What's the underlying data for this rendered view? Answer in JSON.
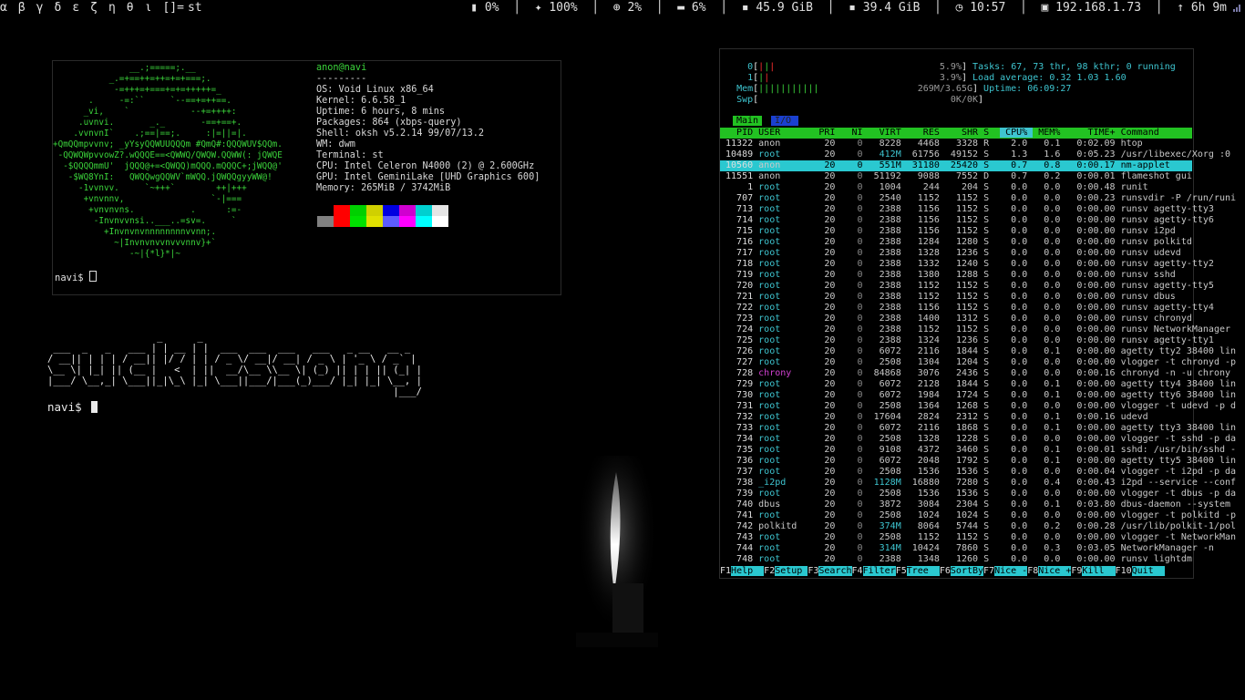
{
  "bar": {
    "tags": [
      "α",
      "β",
      "γ",
      "δ",
      "ε",
      "ζ",
      "η",
      "θ",
      "ι"
    ],
    "layout": "[]=",
    "window_title": "st",
    "battery": "0%",
    "brightness": "100%",
    "cpu": "2%",
    "memory": "6%",
    "disk1": "45.9 GiB",
    "disk2": "39.4 GiB",
    "clock": "10:57",
    "ip": "192.168.1.73",
    "uptime": "6h 9m"
  },
  "neofetch": {
    "userhost": "anon@navi",
    "separator": "---------",
    "lines": [
      "OS: Void Linux x86_64",
      "Kernel: 6.6.58_1",
      "Uptime: 6 hours, 8 mins",
      "Packages: 864 (xbps-query)",
      "Shell: oksh v5.2.14 99/07/13.2",
      "WM: dwm",
      "Terminal: st",
      "CPU: Intel Celeron N4000 (2) @ 2.600GHz",
      "GPU: Intel GeminiLake [UHD Graphics 600]",
      "Memory: 265MiB / 3742MiB"
    ],
    "logo": [
      "               __.;=====;.__",
      "           _.=+==++=++=+=+===;.",
      "            -=+++=+===+=+=+++++=_",
      "       .     -=:``     `--==+=++==.",
      "      _vi,    `            --+=++++:",
      "     .uvnvi.       _._       -==+==+.",
      "    .vvnvnI`    .;==|==;.     :|=||=|.",
      "+QmQQmpvvnv; _yYsyQQWUUQQQm #QmQ#:QQQWUV$QQm.",
      " -QQWQWpvvowZ?.wQQQE==<QWWQ/QWQW.QQWW(: jQWQE",
      "  -$QQQQmmU'  jQQQ@+=<QWQQ)mQQQ.mQQQC+;jWQQ@'",
      "   -$WQ8YnI:   QWQQwgQQWV`mWQQ.jQWQQgyyWW@!",
      "     -1vvnvv.     `~+++`        ++|+++",
      "      +vnvnnv,                 `-|===",
      "       +vnvnvns.           .      :=-",
      "        -Invnvvnsi..___..=sv=.     `",
      "          +Invnvnvnnnnnnnnvvnn;.",
      "            ~|Invnvnvvnvvvnnv}+`",
      "               -~|{*l}*|~"
    ],
    "prompt": "navi$ "
  },
  "figlet_lines": [
    "                   _      _",
    " ___  _   _   ___ | | __ | |  ___  ___  ___   ___   _ __   __ _",
    "/ __|| | | | / __|| |/ / | | / _ \\/ __|/ __| / _ \\ | '_ \\ / _` |",
    "\\__ \\| |_| || (__ |   <  | ||  __/\\__ \\\\__ \\| (_) || | | || (_| |",
    "|___/ \\__,_| \\___||_|\\_\\ |_| \\___||___/|___(_)___/ |_| |_| \\__, |",
    "                                                            |___/"
  ],
  "prompt2": "navi$ ",
  "htop": {
    "cpu0_label": "0",
    "cpu0_pct": "5.9%",
    "cpu1_label": "1",
    "cpu1_pct": "3.9%",
    "mem_label": "Mem",
    "mem_val": "269M/3.65G",
    "swp_label": "Swp",
    "swp_val": "0K/0K",
    "tasks": "Tasks: 67, 73 thr, 98 kthr; 0 running",
    "load": "Load average: 0.32 1.03 1.60",
    "uptime": "Uptime: 06:09:27",
    "tab_main": "Main",
    "tab_io": "I/O",
    "columns": [
      "PID",
      "USER",
      "PRI",
      "NI",
      "VIRT",
      "RES",
      "SHR",
      "S",
      "CPU%",
      "MEM%",
      "TIME+",
      "Command"
    ],
    "processes": [
      [
        "11322",
        "anon",
        "20",
        "0",
        "8228",
        "4468",
        "3328",
        "R",
        "2.0",
        "0.1",
        "0:02.09",
        "htop"
      ],
      [
        "10489",
        "root",
        "20",
        "0",
        "412M",
        "61756",
        "49152",
        "S",
        "1.3",
        "1.6",
        "0:05.23",
        "/usr/libexec/Xorg :0"
      ],
      [
        "10560",
        "anon",
        "20",
        "0",
        "551M",
        "31180",
        "25420",
        "S",
        "0.7",
        "0.8",
        "0:00.17",
        "nm-applet"
      ],
      [
        "11551",
        "anon",
        "20",
        "0",
        "51192",
        "9088",
        "7552",
        "D",
        "0.7",
        "0.2",
        "0:00.01",
        "flameshot gui"
      ],
      [
        "1",
        "root",
        "20",
        "0",
        "1004",
        "244",
        "204",
        "S",
        "0.0",
        "0.0",
        "0:00.48",
        "runit"
      ],
      [
        "707",
        "root",
        "20",
        "0",
        "2540",
        "1152",
        "1152",
        "S",
        "0.0",
        "0.0",
        "0:00.23",
        "runsvdir -P /run/runi"
      ],
      [
        "713",
        "root",
        "20",
        "0",
        "2388",
        "1156",
        "1152",
        "S",
        "0.0",
        "0.0",
        "0:00.00",
        "runsv agetty-tty3"
      ],
      [
        "714",
        "root",
        "20",
        "0",
        "2388",
        "1156",
        "1152",
        "S",
        "0.0",
        "0.0",
        "0:00.00",
        "runsv agetty-tty6"
      ],
      [
        "715",
        "root",
        "20",
        "0",
        "2388",
        "1156",
        "1152",
        "S",
        "0.0",
        "0.0",
        "0:00.00",
        "runsv i2pd"
      ],
      [
        "716",
        "root",
        "20",
        "0",
        "2388",
        "1284",
        "1280",
        "S",
        "0.0",
        "0.0",
        "0:00.00",
        "runsv polkitd"
      ],
      [
        "717",
        "root",
        "20",
        "0",
        "2388",
        "1328",
        "1236",
        "S",
        "0.0",
        "0.0",
        "0:00.00",
        "runsv udevd"
      ],
      [
        "718",
        "root",
        "20",
        "0",
        "2388",
        "1332",
        "1240",
        "S",
        "0.0",
        "0.0",
        "0:00.00",
        "runsv agetty-tty2"
      ],
      [
        "719",
        "root",
        "20",
        "0",
        "2388",
        "1380",
        "1288",
        "S",
        "0.0",
        "0.0",
        "0:00.00",
        "runsv sshd"
      ],
      [
        "720",
        "root",
        "20",
        "0",
        "2388",
        "1152",
        "1152",
        "S",
        "0.0",
        "0.0",
        "0:00.00",
        "runsv agetty-tty5"
      ],
      [
        "721",
        "root",
        "20",
        "0",
        "2388",
        "1152",
        "1152",
        "S",
        "0.0",
        "0.0",
        "0:00.00",
        "runsv dbus"
      ],
      [
        "722",
        "root",
        "20",
        "0",
        "2388",
        "1156",
        "1152",
        "S",
        "0.0",
        "0.0",
        "0:00.00",
        "runsv agetty-tty4"
      ],
      [
        "723",
        "root",
        "20",
        "0",
        "2388",
        "1400",
        "1312",
        "S",
        "0.0",
        "0.0",
        "0:00.00",
        "runsv chronyd"
      ],
      [
        "724",
        "root",
        "20",
        "0",
        "2388",
        "1152",
        "1152",
        "S",
        "0.0",
        "0.0",
        "0:00.00",
        "runsv NetworkManager"
      ],
      [
        "725",
        "root",
        "20",
        "0",
        "2388",
        "1324",
        "1236",
        "S",
        "0.0",
        "0.0",
        "0:00.00",
        "runsv agetty-tty1"
      ],
      [
        "726",
        "root",
        "20",
        "0",
        "6072",
        "2116",
        "1844",
        "S",
        "0.0",
        "0.1",
        "0:00.00",
        "agetty tty2 38400 lin"
      ],
      [
        "727",
        "root",
        "20",
        "0",
        "2508",
        "1304",
        "1204",
        "S",
        "0.0",
        "0.0",
        "0:00.00",
        "vlogger -t chronyd -p"
      ],
      [
        "728",
        "chrony",
        "20",
        "0",
        "84868",
        "3076",
        "2436",
        "S",
        "0.0",
        "0.0",
        "0:00.16",
        "chronyd -n -u chrony"
      ],
      [
        "729",
        "root",
        "20",
        "0",
        "6072",
        "2128",
        "1844",
        "S",
        "0.0",
        "0.1",
        "0:00.00",
        "agetty tty4 38400 lin"
      ],
      [
        "730",
        "root",
        "20",
        "0",
        "6072",
        "1984",
        "1724",
        "S",
        "0.0",
        "0.1",
        "0:00.00",
        "agetty tty6 38400 lin"
      ],
      [
        "731",
        "root",
        "20",
        "0",
        "2508",
        "1364",
        "1268",
        "S",
        "0.0",
        "0.0",
        "0:00.00",
        "vlogger -t udevd -p d"
      ],
      [
        "732",
        "root",
        "20",
        "0",
        "17604",
        "2824",
        "2312",
        "S",
        "0.0",
        "0.1",
        "0:00.16",
        "udevd"
      ],
      [
        "733",
        "root",
        "20",
        "0",
        "6072",
        "2116",
        "1868",
        "S",
        "0.0",
        "0.1",
        "0:00.00",
        "agetty tty3 38400 lin"
      ],
      [
        "734",
        "root",
        "20",
        "0",
        "2508",
        "1328",
        "1228",
        "S",
        "0.0",
        "0.0",
        "0:00.00",
        "vlogger -t sshd -p da"
      ],
      [
        "735",
        "root",
        "20",
        "0",
        "9108",
        "4372",
        "3460",
        "S",
        "0.0",
        "0.1",
        "0:00.01",
        "sshd: /usr/bin/sshd -"
      ],
      [
        "736",
        "root",
        "20",
        "0",
        "6072",
        "2048",
        "1792",
        "S",
        "0.0",
        "0.1",
        "0:00.00",
        "agetty tty5 38400 lin"
      ],
      [
        "737",
        "root",
        "20",
        "0",
        "2508",
        "1536",
        "1536",
        "S",
        "0.0",
        "0.0",
        "0:00.04",
        "vlogger -t i2pd -p da"
      ],
      [
        "738",
        "_i2pd",
        "20",
        "0",
        "1128M",
        "16880",
        "7280",
        "S",
        "0.0",
        "0.4",
        "0:00.43",
        "i2pd --service --conf"
      ],
      [
        "739",
        "root",
        "20",
        "0",
        "2508",
        "1536",
        "1536",
        "S",
        "0.0",
        "0.0",
        "0:00.00",
        "vlogger -t dbus -p da"
      ],
      [
        "740",
        "dbus",
        "20",
        "0",
        "3872",
        "3084",
        "2304",
        "S",
        "0.0",
        "0.1",
        "0:03.80",
        "dbus-daemon --system"
      ],
      [
        "741",
        "root",
        "20",
        "0",
        "2508",
        "1024",
        "1024",
        "S",
        "0.0",
        "0.0",
        "0:00.00",
        "vlogger -t polkitd -p"
      ],
      [
        "742",
        "polkitd",
        "20",
        "0",
        "374M",
        "8064",
        "5744",
        "S",
        "0.0",
        "0.2",
        "0:00.28",
        "/usr/lib/polkit-1/pol"
      ],
      [
        "743",
        "root",
        "20",
        "0",
        "2508",
        "1152",
        "1152",
        "S",
        "0.0",
        "0.0",
        "0:00.00",
        "vlogger -t NetworkMan"
      ],
      [
        "744",
        "root",
        "20",
        "0",
        "314M",
        "10424",
        "7860",
        "S",
        "0.0",
        "0.3",
        "0:03.05",
        "NetworkManager -n"
      ],
      [
        "748",
        "root",
        "20",
        "0",
        "2388",
        "1348",
        "1260",
        "S",
        "0.0",
        "0.0",
        "0:00.00",
        "runsv lightdm"
      ]
    ],
    "fkeys": [
      {
        "key": "F1",
        "label": "Help"
      },
      {
        "key": "F2",
        "label": "Setup"
      },
      {
        "key": "F3",
        "label": "Search"
      },
      {
        "key": "F4",
        "label": "Filter"
      },
      {
        "key": "F5",
        "label": "Tree"
      },
      {
        "key": "F6",
        "label": "SortBy"
      },
      {
        "key": "F7",
        "label": "Nice -"
      },
      {
        "key": "F8",
        "label": "Nice +"
      },
      {
        "key": "F9",
        "label": "Kill"
      },
      {
        "key": "F10",
        "label": "Quit"
      }
    ]
  }
}
